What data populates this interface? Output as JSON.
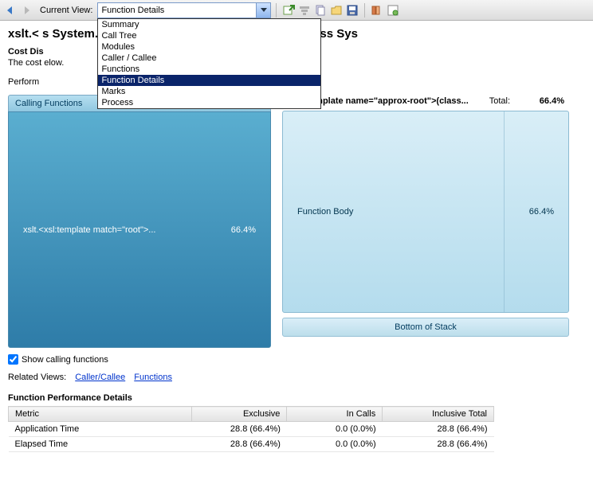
{
  "toolbar": {
    "current_view_label": "Current View:",
    "current_view_value": "Function Details",
    "dropdown_items": [
      "Summary",
      "Call Tree",
      "Modules",
      "Caller / Callee",
      "Functions",
      "Function Details",
      "Marks",
      "Process"
    ],
    "selected_index": 5
  },
  "title": "xslt.<                                                                         s System.Xml.Xsl.Runtime.XmlQueryRuntime,class Sys",
  "cost_dist_label": "Cost Dis",
  "cost_dist_desc": "The cost                                                                                        elow.",
  "perf_label": "Perform",
  "calling_functions": {
    "header": "Calling Functions",
    "item_label": "xslt.<xsl:template match=\"root\">...",
    "item_pct": "66.4%"
  },
  "current_function": {
    "name": "<xsl:template name=\"approx-root\">(class...",
    "total_label": "Total:",
    "total_value": "66.4%",
    "body_label": "Function Body",
    "body_pct": "66.4%",
    "bottom_stack": "Bottom of Stack"
  },
  "show_calling_label": "Show calling functions",
  "show_calling_checked": true,
  "related_views": {
    "label": "Related Views:",
    "links": [
      "Caller/Callee",
      "Functions"
    ]
  },
  "perf_details": {
    "title": "Function Performance Details",
    "columns": [
      "Metric",
      "Exclusive",
      "In Calls",
      "Inclusive Total"
    ],
    "rows": [
      {
        "metric": "Application Time",
        "exclusive": "28.8 (66.4%)",
        "incalls": "0.0 (0.0%)",
        "inclusive": "28.8 (66.4%)"
      },
      {
        "metric": "Elapsed Time",
        "exclusive": "28.8 (66.4%)",
        "incalls": "0.0 (0.0%)",
        "inclusive": "28.8 (66.4%)"
      }
    ]
  }
}
